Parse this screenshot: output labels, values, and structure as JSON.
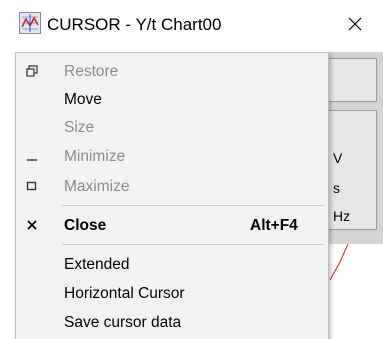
{
  "window": {
    "title": "CURSOR - Y/t Chart00",
    "close_symbol": "✕",
    "icon": "chart-app-icon",
    "side_labels": [
      "V",
      "s",
      "Hz"
    ]
  },
  "menu": {
    "items": [
      {
        "label": "Restore",
        "icon": "restore-icon",
        "symbol": "🗗",
        "enabled": false,
        "bold": false,
        "shortcut": ""
      },
      {
        "label": "Move",
        "icon": "",
        "symbol": "",
        "enabled": true,
        "bold": false,
        "shortcut": ""
      },
      {
        "label": "Size",
        "icon": "",
        "symbol": "",
        "enabled": false,
        "bold": false,
        "shortcut": ""
      },
      {
        "label": "Minimize",
        "icon": "minimize-icon",
        "symbol": "_",
        "enabled": false,
        "bold": false,
        "shortcut": ""
      },
      {
        "label": "Maximize",
        "icon": "maximize-icon",
        "symbol": "□",
        "enabled": false,
        "bold": false,
        "shortcut": ""
      },
      {
        "label": "Close",
        "icon": "close-icon",
        "symbol": "✕",
        "enabled": true,
        "bold": true,
        "shortcut": "Alt+F4"
      },
      {
        "label": "Extended",
        "icon": "",
        "symbol": "",
        "enabled": true,
        "bold": false,
        "shortcut": ""
      },
      {
        "label": "Horizontal Cursor",
        "icon": "",
        "symbol": "",
        "enabled": true,
        "bold": false,
        "shortcut": ""
      },
      {
        "label": "Save cursor data",
        "icon": "",
        "symbol": "",
        "enabled": true,
        "bold": false,
        "shortcut": ""
      }
    ]
  },
  "colors": {
    "menu_bg": "#f2f2f2",
    "disabled_text": "#8c8c8c",
    "panel_bg": "#d4d4d4",
    "chart_line": "#cc2222"
  }
}
